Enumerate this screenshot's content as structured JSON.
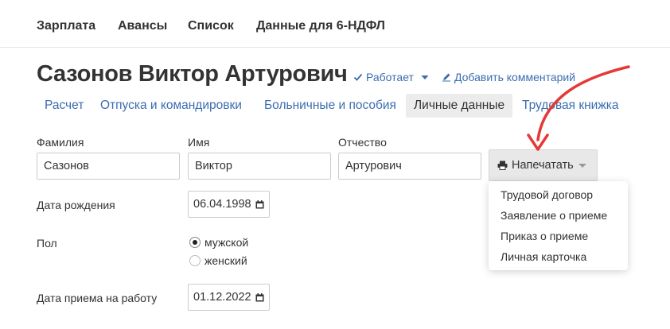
{
  "topnav": {
    "items": [
      "Зарплата",
      "Авансы",
      "Список",
      "Данные для 6-НДФЛ"
    ]
  },
  "employee": {
    "full_name": "Сазонов Виктор Артурович",
    "status_label": "Работает",
    "comment_label": "Добавить комментарий"
  },
  "tabs": [
    {
      "label": "Расчет",
      "active": false
    },
    {
      "label": "Отпуска и командировки",
      "active": false
    },
    {
      "label": "Больничные и пособия",
      "active": false
    },
    {
      "label": "Личные данные",
      "active": true
    },
    {
      "label": "Трудовая книжка",
      "active": false
    }
  ],
  "form": {
    "last_name_label": "Фамилия",
    "last_name_value": "Сазонов",
    "first_name_label": "Имя",
    "first_name_value": "Виктор",
    "patronymic_label": "Отчество",
    "patronymic_value": "Артурович",
    "birth_date_label": "Дата рождения",
    "birth_date_value": "06.04.1998",
    "gender_label": "Пол",
    "gender_options": [
      {
        "label": "мужской",
        "checked": true
      },
      {
        "label": "женский",
        "checked": false
      }
    ],
    "hire_date_label": "Дата приема на работу",
    "hire_date_value": "01.12.2022"
  },
  "print_menu": {
    "button_label": "Напечатать",
    "items": [
      "Трудовой договор",
      "Заявление о приеме",
      "Приказ о приеме",
      "Личная карточка"
    ]
  },
  "colors": {
    "link": "#3b6db0",
    "text": "#333333",
    "arrow": "#e53935",
    "active_tab_bg": "#ececec"
  }
}
